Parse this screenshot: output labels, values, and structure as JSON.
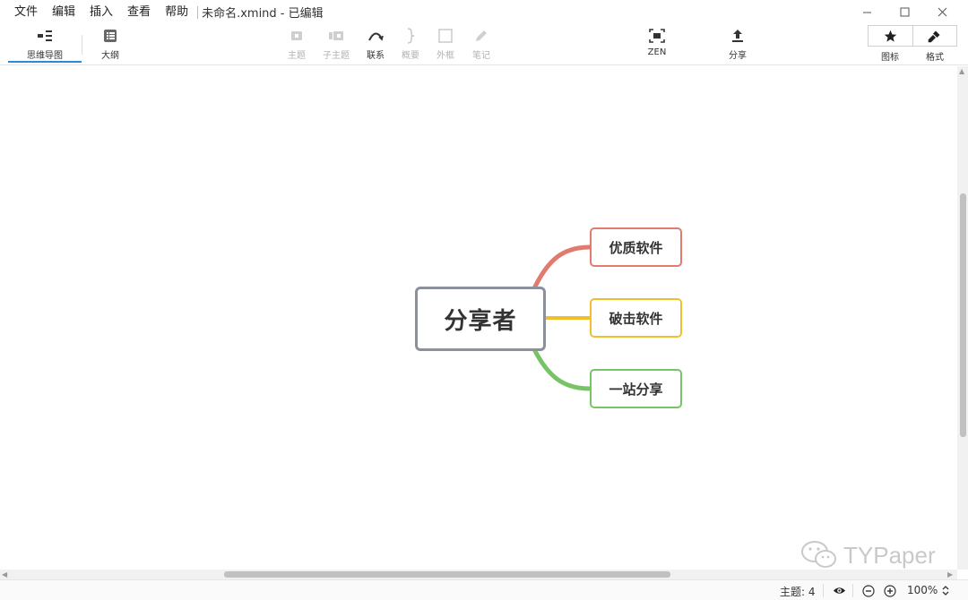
{
  "menu": [
    "文件",
    "编辑",
    "插入",
    "查看",
    "帮助"
  ],
  "document_title": "未命名.xmind - 已编辑",
  "toolbar": {
    "mindmap": "思维导图",
    "outline": "大纲",
    "topic": "主题",
    "subtopic": "子主题",
    "relationship": "联系",
    "summary": "概要",
    "boundary": "外框",
    "note": "笔记",
    "zen": "ZEN",
    "share": "分享",
    "icons": "图标",
    "format": "格式"
  },
  "map": {
    "central": "分享者",
    "topics": [
      "优质软件",
      "破击软件",
      "一站分享"
    ]
  },
  "colors": {
    "branch_1": "#e17a6f",
    "branch_2": "#f0c02c",
    "branch_3": "#76c466",
    "central_border": "#8a919a",
    "active_tab": "#2a8bd8"
  },
  "watermark": "TYPaper",
  "status": {
    "topic_count": "主题: 4",
    "zoom": "100%"
  }
}
